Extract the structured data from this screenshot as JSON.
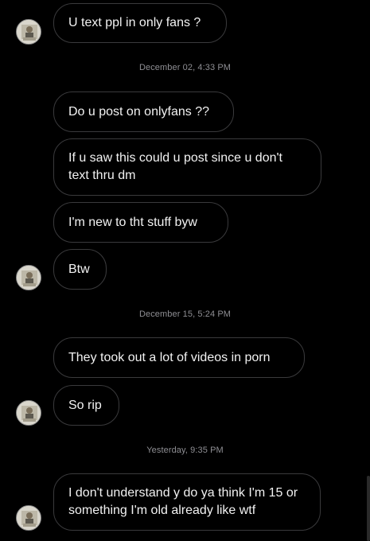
{
  "messages": {
    "m1": "U text ppl in only fans ?",
    "m2": "Do u post on onlyfans ??",
    "m3": "If u saw this could u post since u don't text thru dm",
    "m4": "I'm new to tht stuff byw",
    "m5": "Btw",
    "m6": "They took out a lot of videos in porn",
    "m7": "So rip",
    "m8": "I don't understand y do ya think I'm 15 or something I'm old already like wtf"
  },
  "timestamps": {
    "t1": "December 02, 4:33 PM",
    "t2": "December 15, 5:24 PM",
    "t3": "Yesterday, 9:35 PM"
  },
  "icons": {
    "avatar": "contact-profile-photo"
  }
}
